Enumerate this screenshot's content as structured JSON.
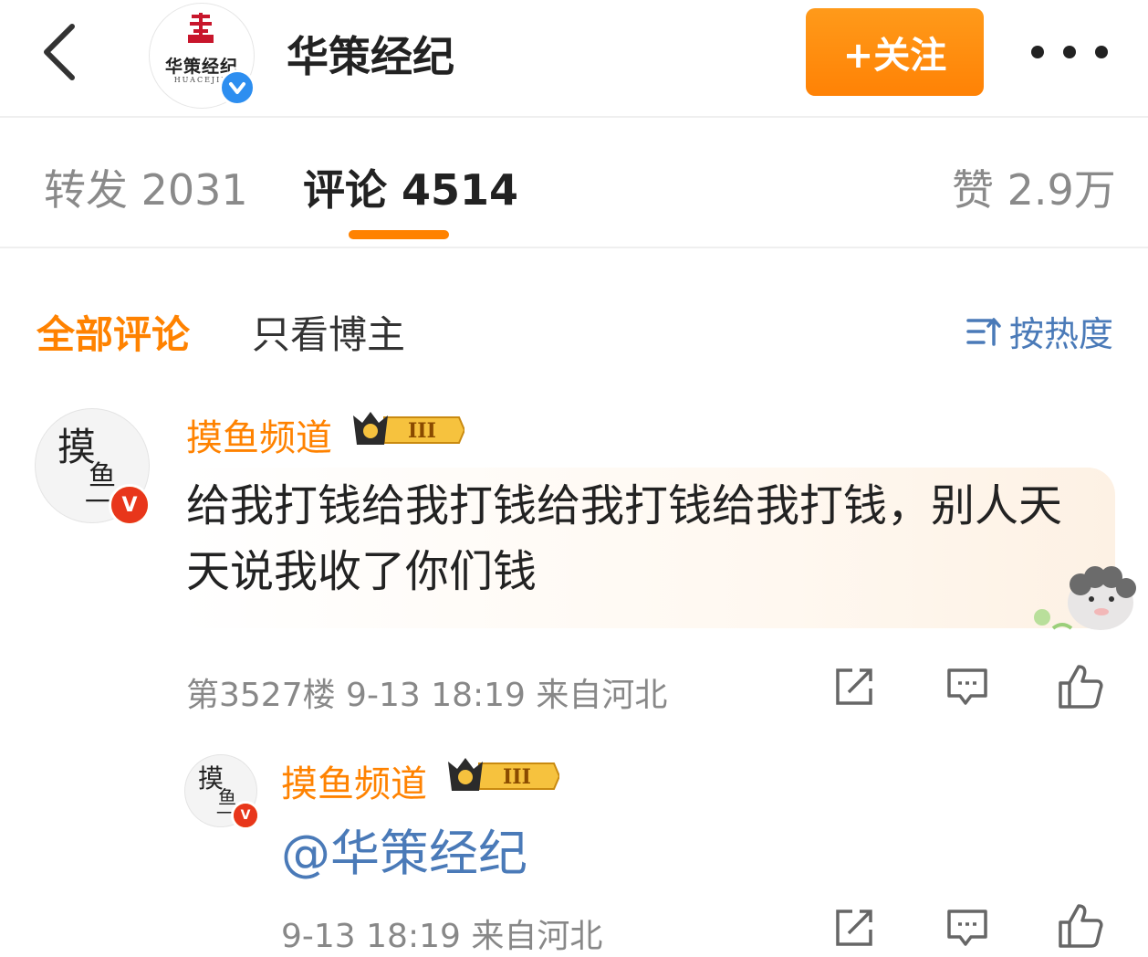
{
  "header": {
    "title": "华策经纪",
    "follow_label": "+关注",
    "avatar": {
      "brand_text": "华策经纪",
      "brand_sub": "HUACEJIN"
    }
  },
  "tabs": [
    {
      "label": "转发 2031"
    },
    {
      "label": "评论 4514"
    },
    {
      "label": "赞 2.9万"
    }
  ],
  "filters": {
    "all": "全部评论",
    "author_only": "只看博主",
    "sort": "按热度"
  },
  "comments": [
    {
      "user": "摸鱼频道",
      "avatar_text": [
        "摸",
        "鱼",
        "一"
      ],
      "level_badge": "III",
      "text": "给我打钱给我打钱给我打钱给我打钱，别人天天说我收了你们钱",
      "meta": "第3527楼 9-13 18:19 来自河北"
    }
  ],
  "reply": {
    "user": "摸鱼频道",
    "avatar_text": [
      "摸",
      "鱼",
      "一"
    ],
    "level_badge": "III",
    "text": "@华策经纪",
    "meta": "9-13 18:19 来自河北"
  },
  "colors": {
    "accent": "#ff8200",
    "link": "#4a7ab8",
    "verified_blue": "#2d8ef0",
    "vip_red": "#e8361b"
  },
  "icons": [
    "back-arrow-icon",
    "verified-icon",
    "more-icon",
    "sort-icon",
    "crown-icon",
    "repost-icon",
    "comment-icon",
    "like-icon",
    "sheep-sticker-icon"
  ]
}
